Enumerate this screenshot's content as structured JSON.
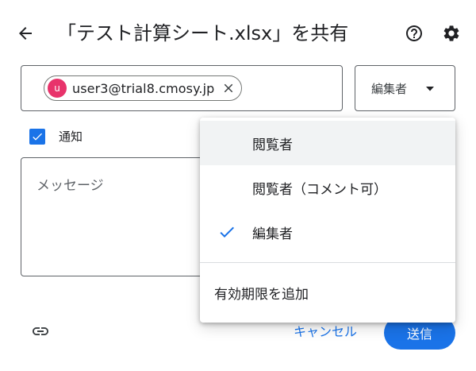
{
  "header": {
    "title": "「テスト計算シート.xlsx」を共有",
    "back_icon": "arrow-back-icon",
    "help_icon": "help-circle-icon",
    "settings_icon": "gear-icon"
  },
  "recipients": {
    "chips": [
      {
        "avatar_letter": "u",
        "avatar_color": "#e8336b",
        "email": "user3@trial8.cmosy.jp"
      }
    ]
  },
  "role_select": {
    "selected": "編集者"
  },
  "notify": {
    "label": "通知",
    "checked": true
  },
  "message": {
    "placeholder": "メッセージ"
  },
  "footer": {
    "cancel_label": "キャンセル",
    "send_label": "送信"
  },
  "role_menu": {
    "items": [
      {
        "label": "閲覧者",
        "checked": false,
        "hovered": true
      },
      {
        "label": "閲覧者（コメント可）",
        "checked": false,
        "hovered": false
      },
      {
        "label": "編集者",
        "checked": true,
        "hovered": false
      }
    ],
    "expiry_label": "有効期限を追加"
  },
  "colors": {
    "accent": "#1a73e8",
    "avatar": "#e8336b",
    "border": "#5f6368",
    "hover": "#f1f3f4"
  }
}
